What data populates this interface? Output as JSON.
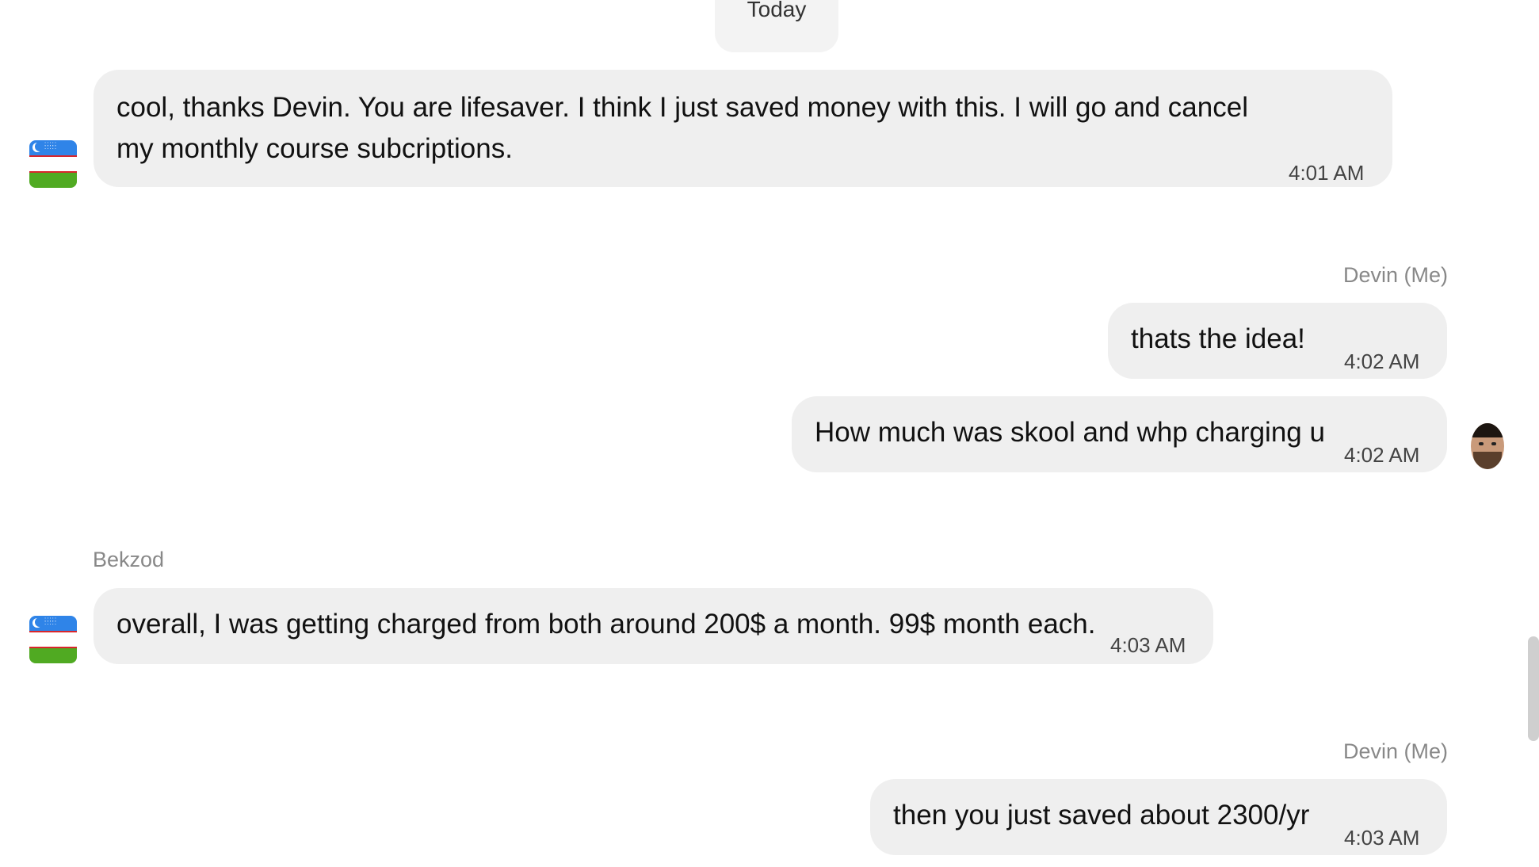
{
  "date_separator": "Today",
  "messages": [
    {
      "sender": "",
      "lines": [
        "cool, thanks Devin. You are lifesaver. I think I just saved money with this. I will go  and cancel",
        "my monthly course subcriptions."
      ],
      "time": "4:01 AM"
    },
    {
      "sender": "Devin (Me)",
      "text": "thats the idea!",
      "time": "4:02 AM"
    },
    {
      "sender": "",
      "text": "How much was skool and whp charging u",
      "time": "4:02 AM"
    },
    {
      "sender": "Bekzod",
      "text": "overall, I was getting charged from both around 200$ a month. 99$ month each.",
      "time": "4:03 AM"
    },
    {
      "sender": "Devin (Me)",
      "text": "then you just saved about 2300/yr",
      "time": "4:03 AM"
    }
  ],
  "icons": {
    "contact_avatar": "uzbekistan-flag-icon",
    "my_avatar": "user-avatar-icon"
  },
  "colors": {
    "bubble": "#efefef",
    "sender_label": "#888888",
    "time": "#444444"
  }
}
